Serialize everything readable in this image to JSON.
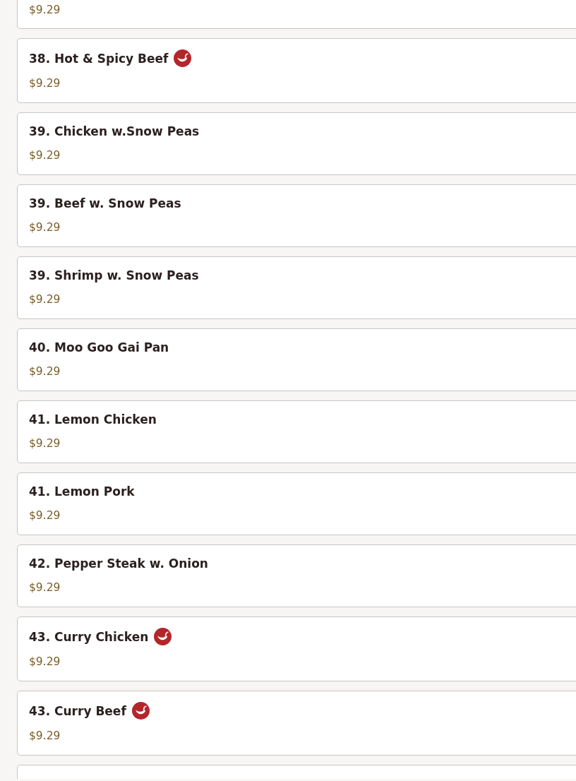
{
  "items": [
    {
      "price": "$9.29"
    },
    {
      "name": "38. Hot & Spicy Beef",
      "spicy": true,
      "price": "$9.29"
    },
    {
      "name": "39. Chicken w.Snow Peas",
      "spicy": false,
      "price": "$9.29"
    },
    {
      "name": "39. Beef w. Snow Peas",
      "spicy": false,
      "price": "$9.29"
    },
    {
      "name": "39. Shrimp w. Snow Peas",
      "spicy": false,
      "price": "$9.29"
    },
    {
      "name": "40. Moo Goo Gai Pan",
      "spicy": false,
      "price": "$9.29"
    },
    {
      "name": "41. Lemon Chicken",
      "spicy": false,
      "price": "$9.29"
    },
    {
      "name": "41. Lemon Pork",
      "spicy": false,
      "price": "$9.29"
    },
    {
      "name": "42. Pepper Steak w. Onion",
      "spicy": false,
      "price": "$9.29"
    },
    {
      "name": "43. Curry Chicken",
      "spicy": true,
      "price": "$9.29"
    },
    {
      "name": "43. Curry Beef",
      "spicy": true,
      "price": "$9.29"
    }
  ]
}
